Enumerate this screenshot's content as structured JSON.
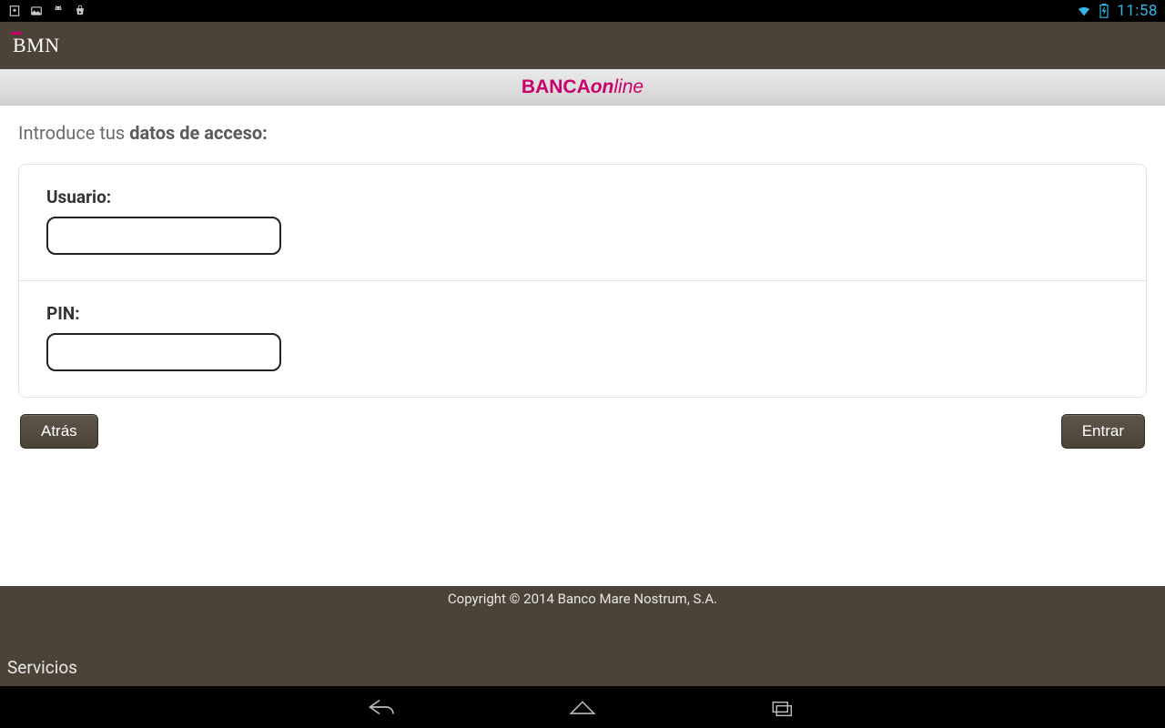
{
  "status_bar": {
    "clock": "11:58"
  },
  "app_header": {
    "logo_text": "BMN"
  },
  "banner": {
    "prefix": "BANCA",
    "on": "on",
    "line": "line"
  },
  "content": {
    "intro_prefix": "Introduce tus ",
    "intro_bold": "datos de acceso:",
    "form": {
      "user_label": "Usuario:",
      "user_value": "",
      "pin_label": "PIN:",
      "pin_value": ""
    },
    "buttons": {
      "back": "Atrás",
      "enter": "Entrar"
    }
  },
  "footer": {
    "copyright": "Copyright © 2014 Banco Mare Nostrum, S.A."
  },
  "services": {
    "label": "Servicios"
  }
}
